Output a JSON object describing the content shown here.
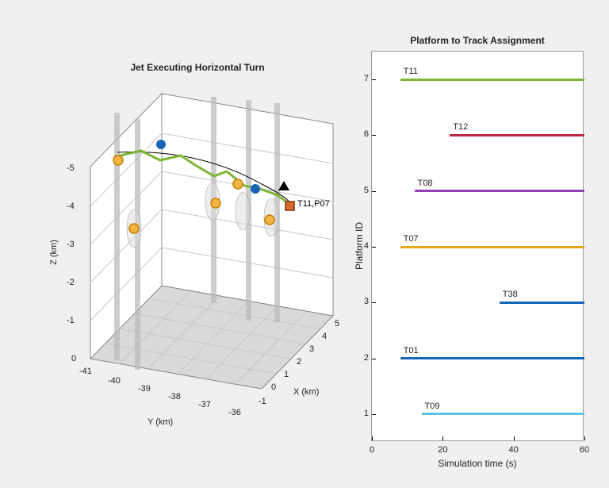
{
  "left": {
    "title": "Jet Executing Horizontal Turn",
    "xlabel": "X (km)",
    "ylabel": "Y (km)",
    "zlabel": "Z (km)",
    "xticks": [
      "-1",
      "0",
      "1",
      "2",
      "3",
      "4",
      "5"
    ],
    "yticks": [
      "-41",
      "-40",
      "-39",
      "-38",
      "-37",
      "-36"
    ],
    "zticks": [
      "-5",
      "-4",
      "-3",
      "-2",
      "-1",
      "0"
    ],
    "annotation": "T11,P07"
  },
  "right": {
    "title": "Platform to Track Assignment",
    "xlabel": "Simulation time (s)",
    "ylabel": "Platform ID",
    "xlim": [
      0,
      60
    ],
    "ylim": [
      0.5,
      7.5
    ],
    "xticks": [
      0,
      20,
      40,
      60
    ],
    "yticks": [
      1,
      2,
      3,
      4,
      5,
      6,
      7
    ]
  },
  "chart_data": {
    "type": "gantt",
    "xlabel": "Simulation time (s)",
    "ylabel": "Platform ID",
    "xlim": [
      0,
      60
    ],
    "ylim": [
      0.5,
      7.5
    ],
    "series": [
      {
        "name": "T11",
        "platform": 7,
        "start": 8,
        "end": 60,
        "color": "#7db535"
      },
      {
        "name": "T12",
        "platform": 6,
        "start": 22,
        "end": 60,
        "color": "#be2643"
      },
      {
        "name": "T08",
        "platform": 5,
        "start": 12,
        "end": 60,
        "color": "#8e3fb1"
      },
      {
        "name": "T07",
        "platform": 4,
        "start": 8,
        "end": 60,
        "color": "#e6a817"
      },
      {
        "name": "T38",
        "platform": 3,
        "start": 36,
        "end": 60,
        "color": "#1565b8"
      },
      {
        "name": "T01",
        "platform": 2,
        "start": 8,
        "end": 60,
        "color": "#1565b8"
      },
      {
        "name": "T09",
        "platform": 1,
        "start": 14,
        "end": 60,
        "color": "#5bc3e6"
      }
    ]
  }
}
